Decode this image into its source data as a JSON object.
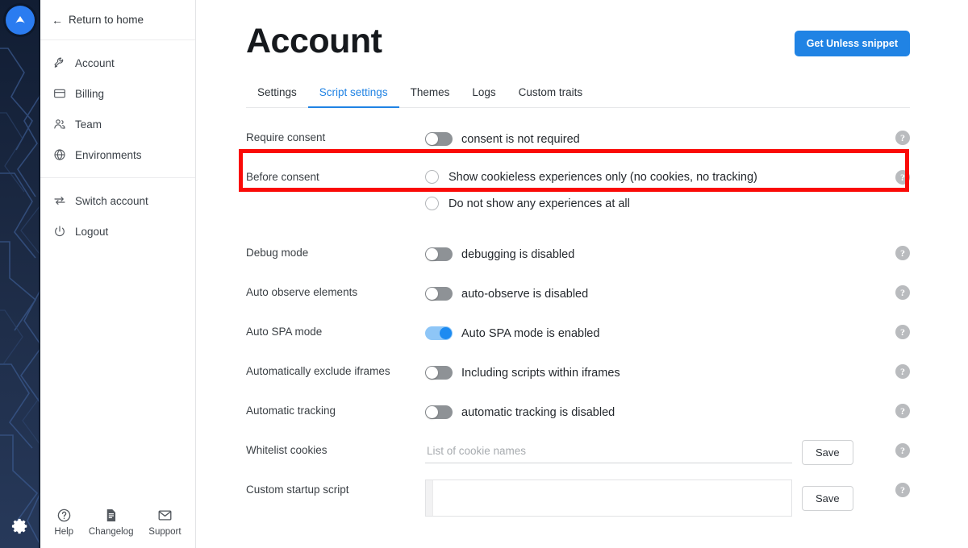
{
  "rail": {
    "logo_icon": "unless-logo-icon",
    "gear_icon": "gear-icon"
  },
  "sidebar": {
    "return_label": "Return to home",
    "return_icon": "arrow-left-icon",
    "groups": [
      {
        "items": [
          {
            "label": "Account",
            "icon": "wrench-icon"
          },
          {
            "label": "Billing",
            "icon": "credit-card-icon"
          },
          {
            "label": "Team",
            "icon": "people-icon"
          },
          {
            "label": "Environments",
            "icon": "globe-icon"
          }
        ]
      },
      {
        "items": [
          {
            "label": "Switch account",
            "icon": "switch-arrows-icon"
          },
          {
            "label": "Logout",
            "icon": "power-icon"
          }
        ]
      }
    ],
    "bottom": [
      {
        "label": "Help",
        "icon": "question-circle-icon"
      },
      {
        "label": "Changelog",
        "icon": "document-icon"
      },
      {
        "label": "Support",
        "icon": "envelope-icon"
      }
    ]
  },
  "header": {
    "title": "Account",
    "snippet_button": "Get Unless snippet"
  },
  "tabs": [
    {
      "label": "Settings",
      "active": false
    },
    {
      "label": "Script settings",
      "active": true
    },
    {
      "label": "Themes",
      "active": false
    },
    {
      "label": "Logs",
      "active": false
    },
    {
      "label": "Custom traits",
      "active": false
    }
  ],
  "settings": {
    "require_consent": {
      "label": "Require consent",
      "toggle_state": "off",
      "toggle_text": "consent is not required",
      "help_glyph": "?"
    },
    "before_consent": {
      "label": "Before consent",
      "options": [
        {
          "label": "Show cookieless experiences only (no cookies, no tracking)",
          "checked": false
        },
        {
          "label": "Do not show any experiences at all",
          "checked": false
        }
      ],
      "help_glyph": "?"
    },
    "debug_mode": {
      "label": "Debug mode",
      "toggle_state": "off",
      "toggle_text": "debugging is disabled",
      "help_glyph": "?"
    },
    "auto_observe": {
      "label": "Auto observe elements",
      "toggle_state": "off",
      "toggle_text": "auto-observe is disabled",
      "help_glyph": "?"
    },
    "auto_spa": {
      "label": "Auto SPA mode",
      "toggle_state": "on",
      "toggle_text": "Auto SPA mode is enabled",
      "help_glyph": "?"
    },
    "exclude_iframes": {
      "label": "Automatically exclude iframes",
      "toggle_state": "off",
      "toggle_text": "Including scripts within iframes",
      "help_glyph": "?"
    },
    "automatic_tracking": {
      "label": "Automatic tracking",
      "toggle_state": "off",
      "toggle_text": "automatic tracking is disabled",
      "help_glyph": "?"
    },
    "whitelist_cookies": {
      "label": "Whitelist cookies",
      "value": "",
      "placeholder": "List of cookie names",
      "save_label": "Save",
      "help_glyph": "?"
    },
    "custom_startup_script": {
      "label": "Custom startup script",
      "value": "",
      "save_label": "Save",
      "help_glyph": "?"
    }
  },
  "annotation": {
    "target": "require-consent-row",
    "color": "#fa0a07"
  },
  "colors": {
    "accent": "#2083e4",
    "toggle_on": "#1d8bf1",
    "toggle_on_track": "#8ec6f7",
    "toggle_off": "#8e9296",
    "rail_bg": "#1b2840",
    "highlight": "#fa0a07"
  }
}
